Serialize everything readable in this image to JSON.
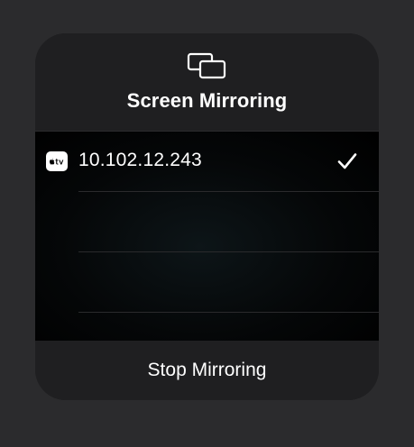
{
  "panel": {
    "icon": "screen-mirroring-icon",
    "title": "Screen Mirroring"
  },
  "devices": [
    {
      "name": "10.102.12.243",
      "badge_icon": "apple-tv-icon",
      "selected": true,
      "selected_icon": "checkmark-icon"
    }
  ],
  "footer": {
    "stop_label": "Stop Mirroring"
  },
  "colors": {
    "background": "#2b2b2d",
    "panel": "#1f1f21",
    "list_background": "#000000",
    "text": "#ffffff"
  }
}
